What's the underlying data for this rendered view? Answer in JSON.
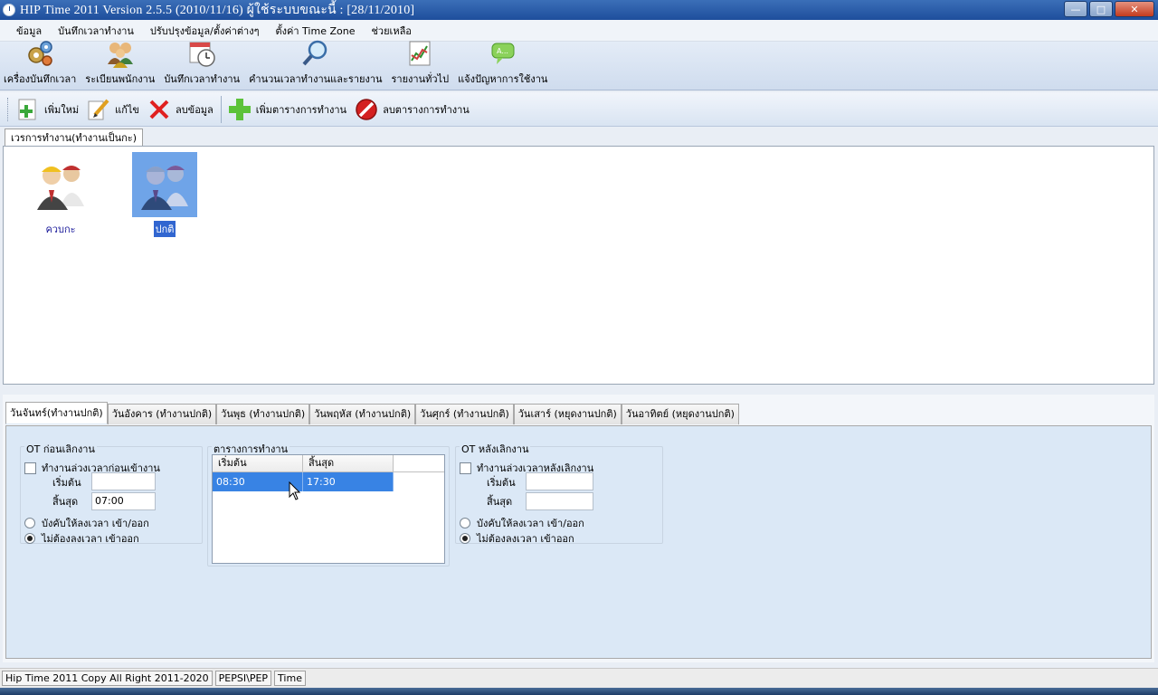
{
  "window": {
    "title": "HIP Time 2011 Version 2.5.5 (2010/11/16)   ผู้ใช้ระบบขณะนี้  :  [28/11/2010]",
    "buttons": {
      "minimize": "—",
      "maximize": "□",
      "close": "✕"
    }
  },
  "menu": [
    "ข้อมูล",
    "บันทึกเวลาทำงาน",
    "ปรับปรุงข้อมูล/ตั้งค่าต่างๆ",
    "ตั้งค่า Time Zone",
    "ช่วยเหลือ"
  ],
  "main_toolbar": [
    {
      "label": "เครื่องบันทึกเวลา",
      "icon": "gears-icon"
    },
    {
      "label": "ระเบียนพนักงาน",
      "icon": "employees-icon"
    },
    {
      "label": "บันทึกเวลาทำงาน",
      "icon": "calendar-clock-icon"
    },
    {
      "label": "คำนวนเวลาทำงานและรายงาน",
      "icon": "magnifier-icon"
    },
    {
      "label": "รายงานทั่วไป",
      "icon": "report-chart-icon"
    },
    {
      "label": "แจ้งปัญหาการใช้งาน",
      "icon": "chat-bubble-icon"
    }
  ],
  "action_toolbar": {
    "add": "เพิ่มใหม่",
    "edit": "แก้ไข",
    "delete": "ลบข้อมูล",
    "add_schedule": "เพิ่มตารางการทำงาน",
    "delete_schedule": "ลบตารางการทำงาน"
  },
  "upper_tab": "เวรการทำงาน(ทำงานเป็นกะ)",
  "shifts": [
    {
      "label": "ควบกะ",
      "selected": false
    },
    {
      "label": "ปกติ",
      "selected": true
    }
  ],
  "day_tabs": [
    "วันจันทร์(ทำงานปกติ)",
    "วันอังคาร (ทำงานปกติ)",
    "วันพุธ (ทำงานปกติ)",
    "วันพฤหัส (ทำงานปกติ)",
    "วันศุกร์ (ทำงานปกติ)",
    "วันเสาร์ (หยุดงานปกติ)",
    "วันอาทิตย์ (หยุดงานปกติ)"
  ],
  "ot_before": {
    "title": "OT ก่อนเลิกงาน",
    "checkbox_label": "ทำงานล่วงเวลาก่อนเข้างาน",
    "start_label": "เริ่มต้น",
    "start_value": "",
    "end_label": "สิ้นสุด",
    "end_value": "07:00",
    "radio_force": "บังคับให้ลงเวลา เข้า/ออก",
    "radio_none": "ไม่ต้องลงเวลา เข้าออก",
    "selected": "none"
  },
  "schedule": {
    "title": "ตารางการทำงาน",
    "columns": [
      "เริ่มต้น",
      "สิ้นสุด"
    ],
    "rows": [
      [
        "08:30",
        "17:30"
      ]
    ]
  },
  "ot_after": {
    "title": "OT หลังเลิกงาน",
    "checkbox_label": "ทำงานล่วงเวลาหลังเลิกงาน",
    "start_label": "เริ่มต้น",
    "start_value": "",
    "end_label": "สิ้นสุด",
    "end_value": "",
    "radio_force": "บังคับให้ลงเวลา เข้า/ออก",
    "radio_none": "ไม่ต้องลงเวลา เข้าออก",
    "selected": "none"
  },
  "status": [
    "Hip Time 2011 Copy All Right 2011-2020",
    "PEPSI\\PEP",
    "Time"
  ]
}
